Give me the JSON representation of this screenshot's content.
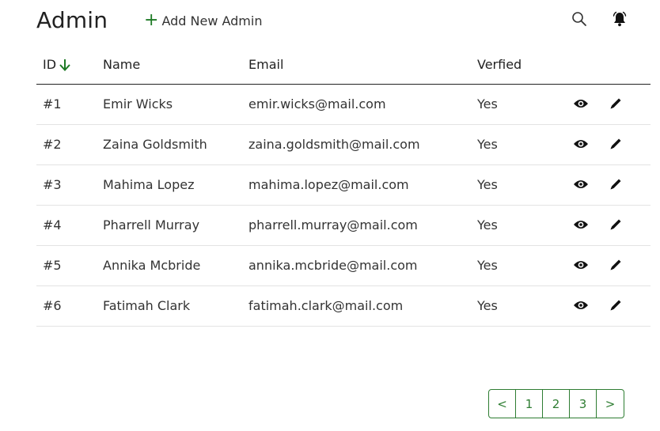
{
  "header": {
    "title": "Admin",
    "add_label": "Add New Admin",
    "add_icon": "+",
    "search_icon": "search-icon",
    "notification_icon": "bell-icon"
  },
  "table": {
    "columns": {
      "id": "ID",
      "name": "Name",
      "email": "Email",
      "verified": "Verfied"
    },
    "sort_icon": "arrow-down-icon",
    "rows": [
      {
        "id": "#1",
        "name": "Emir Wicks",
        "email": "emir.wicks@mail.com",
        "verified": "Yes"
      },
      {
        "id": "#2",
        "name": "Zaina Goldsmith",
        "email": "zaina.goldsmith@mail.com",
        "verified": "Yes"
      },
      {
        "id": "#3",
        "name": "Mahima Lopez",
        "email": "mahima.lopez@mail.com",
        "verified": "Yes"
      },
      {
        "id": "#4",
        "name": "Pharrell Murray",
        "email": "pharrell.murray@mail.com",
        "verified": "Yes"
      },
      {
        "id": "#5",
        "name": "Annika Mcbride",
        "email": "annika.mcbride@mail.com",
        "verified": "Yes"
      },
      {
        "id": "#6",
        "name": "Fatimah Clark",
        "email": "fatimah.clark@mail.com",
        "verified": "Yes"
      }
    ],
    "row_actions": [
      "eye-icon",
      "pencil-icon"
    ]
  },
  "pagination": {
    "prev": "<",
    "pages": [
      "1",
      "2",
      "3"
    ],
    "next": ">"
  },
  "colors": {
    "accent": "#2e7d32",
    "text": "#222222",
    "divider": "#e3e3e3"
  }
}
